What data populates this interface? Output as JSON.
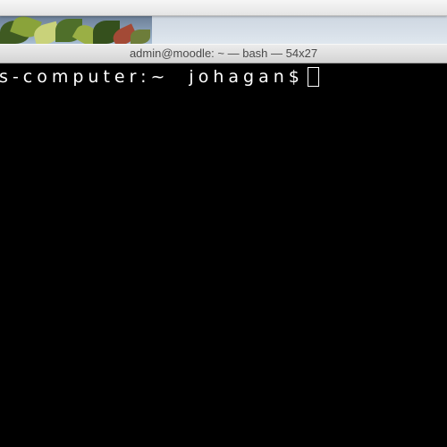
{
  "window": {
    "title": "admin@moodle: ~ — bash — 54x27"
  },
  "terminal": {
    "prompt_host": "ns-computer:~",
    "prompt_user": "johagan$",
    "cursor": "block-outline-cursor"
  },
  "colors": {
    "terminal_background": "#000000",
    "terminal_text": "#ffffff",
    "title_bar": "#e0e0e0"
  }
}
